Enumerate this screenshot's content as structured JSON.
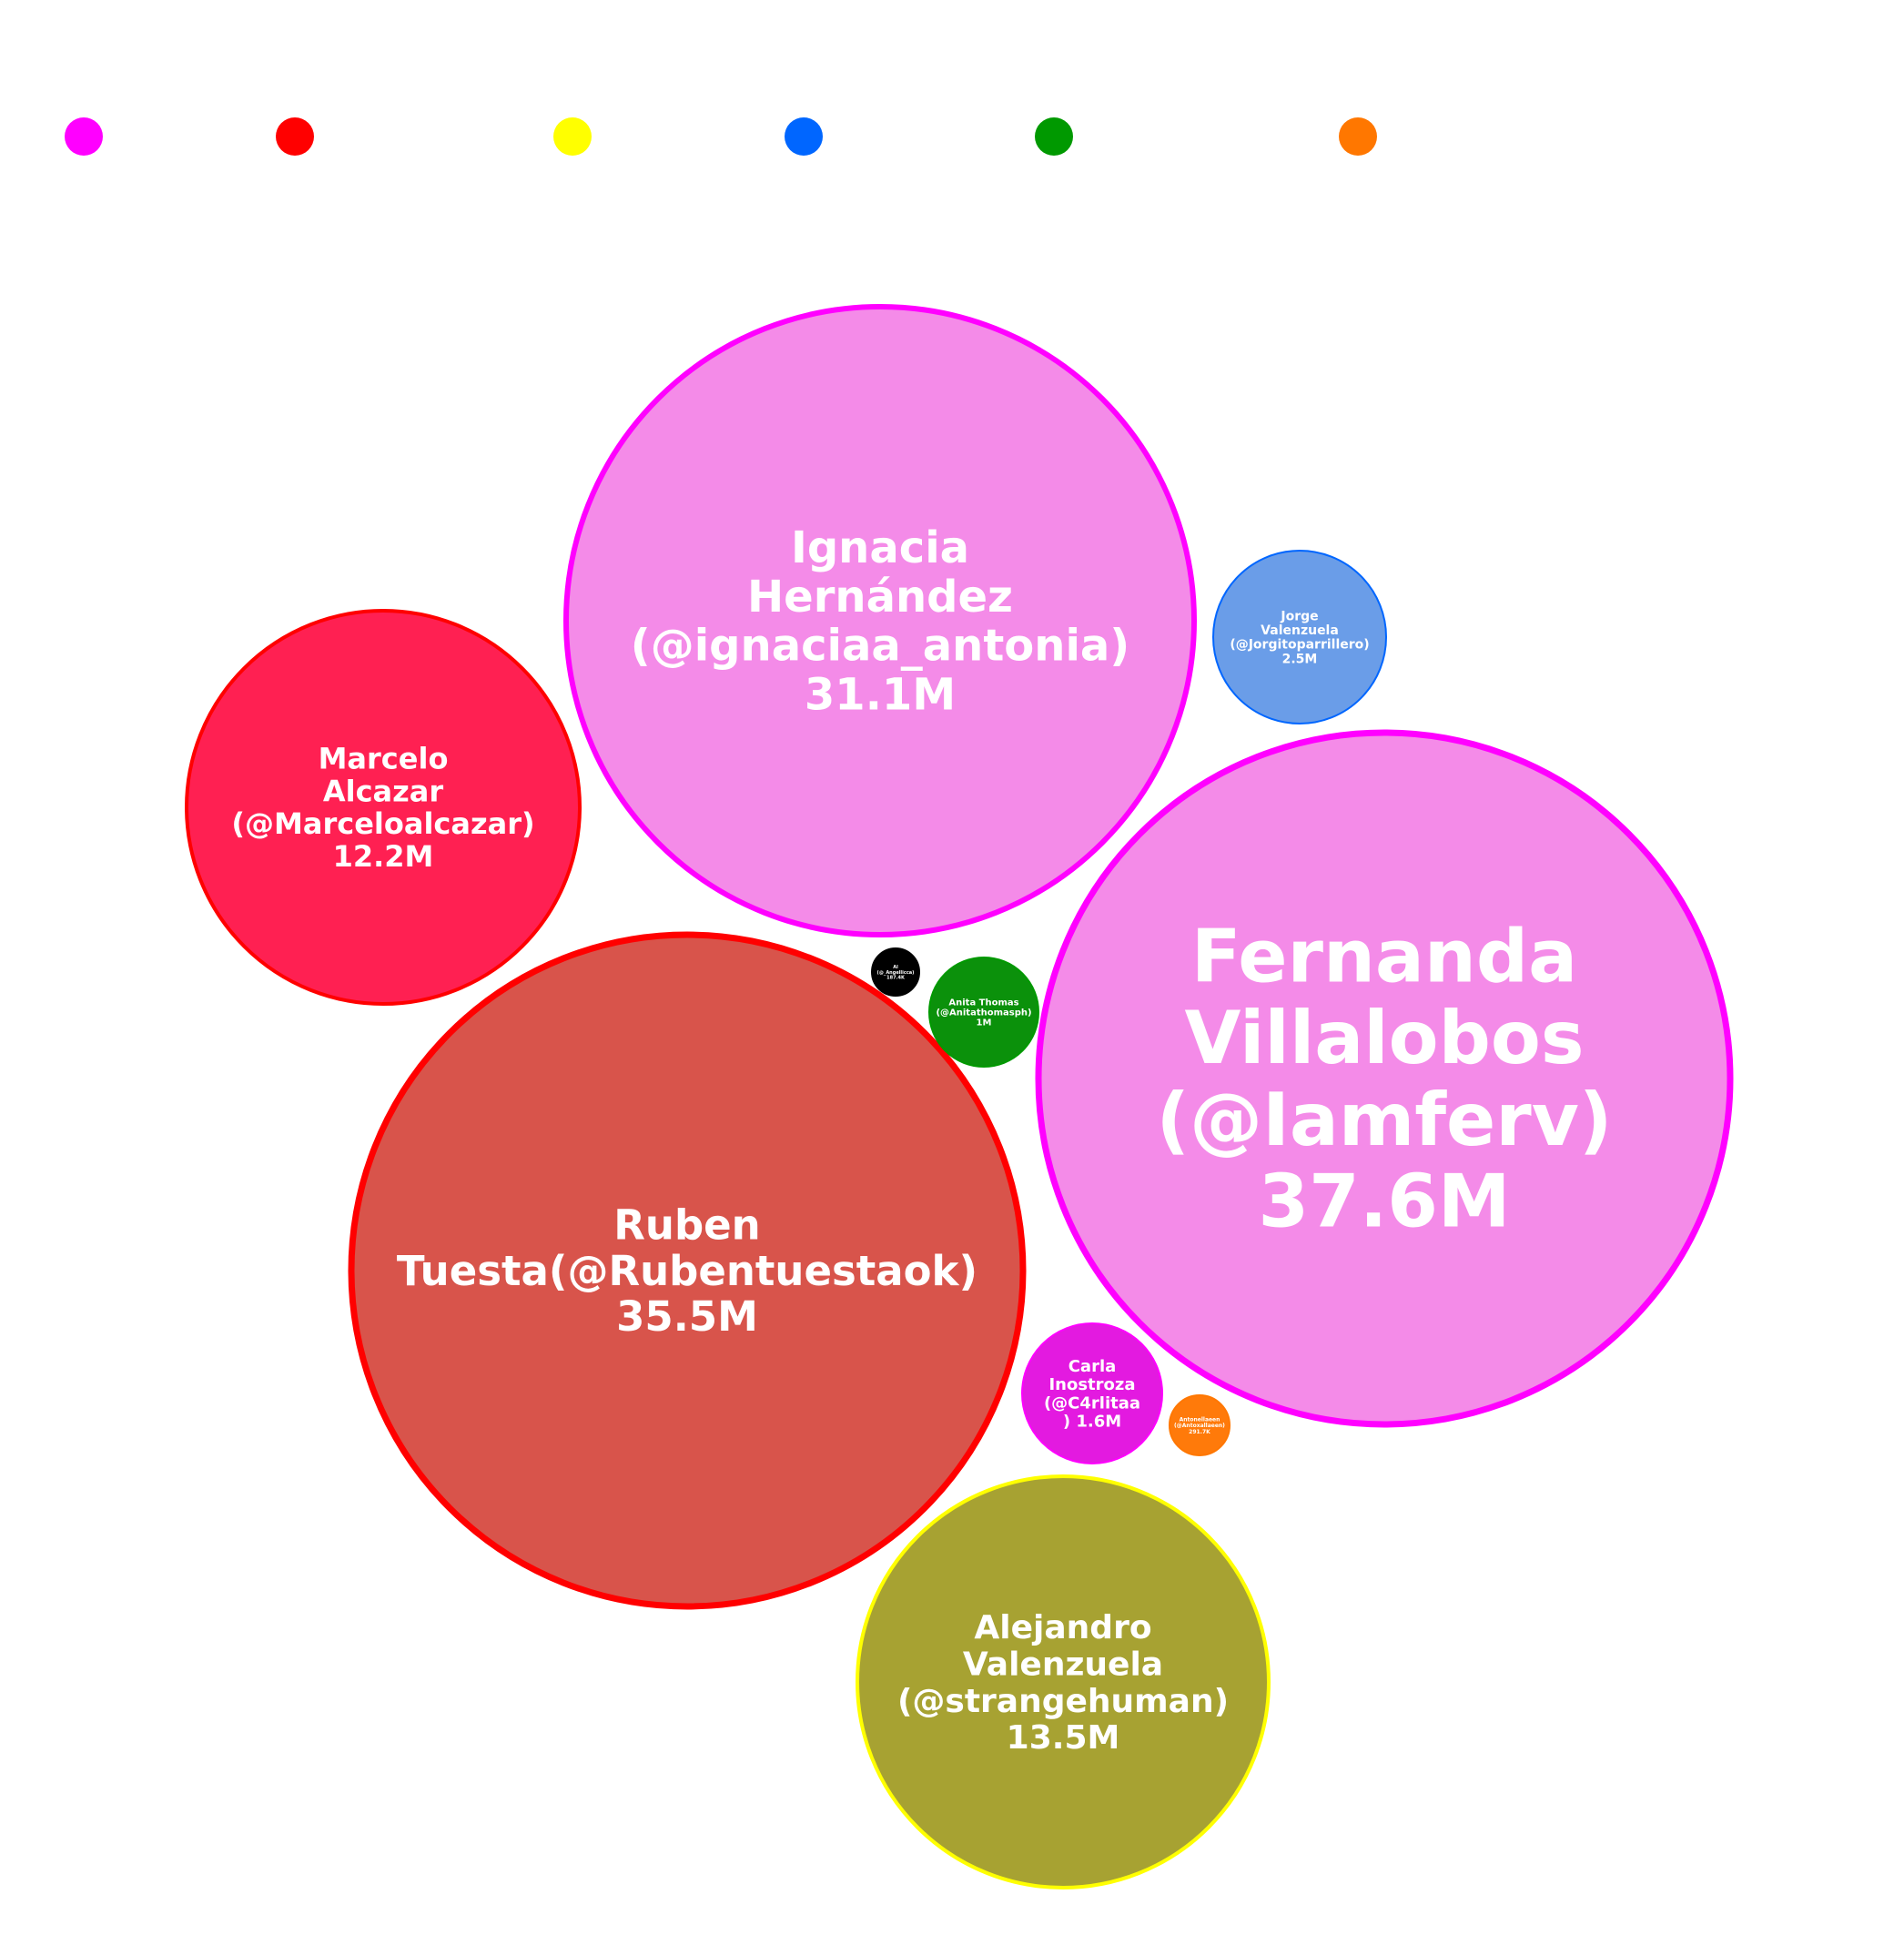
{
  "chart_data": {
    "type": "bubble",
    "legend": {
      "placement": "top-left",
      "colors": [
        "#ff00ff",
        "#ff0000",
        "#ffff00",
        "#0066ff",
        "#009900",
        "#ff7700"
      ]
    },
    "bubbles": [
      {
        "id": "fernanda",
        "lines": [
          "Fernanda",
          "Villalobos",
          "(@Iamferv)",
          "37.6M"
        ],
        "value": 37.6,
        "color": "#ff00ff",
        "fill": "#f48be8"
      },
      {
        "id": "ruben",
        "lines": [
          "Ruben",
          "Tuesta(@Rubentuestaok)",
          "35.5M"
        ],
        "value": 35.5,
        "color": "#ff0000",
        "fill": "#d8544b"
      },
      {
        "id": "ignacia",
        "lines": [
          "Ignacia",
          "Hernández",
          "(@ignaciaa_antonia)",
          "31.1M"
        ],
        "value": 31.1,
        "color": "#ff00ff",
        "fill": "#f48be8"
      },
      {
        "id": "alejandro",
        "lines": [
          "Alejandro",
          "Valenzuela",
          "(@strangehuman)",
          "13.5M"
        ],
        "value": 13.5,
        "color": "#ffff00",
        "fill": "#a7a232"
      },
      {
        "id": "marcelo",
        "lines": [
          "Marcelo",
          "Alcazar",
          "(@Marceloalcazar)",
          "12.2M"
        ],
        "value": 12.2,
        "color": "#ff0000",
        "fill": "#ff2052"
      },
      {
        "id": "jorge",
        "lines": [
          "Jorge",
          "Valenzuela",
          "(@Jorgitoparrillero)",
          "2.5M"
        ],
        "value": 2.5,
        "color": "#0066ff",
        "fill": "#6a9de8"
      },
      {
        "id": "carla",
        "lines": [
          "Carla",
          "Inostroza",
          "(@C4rlitaa",
          ") 1.6M"
        ],
        "value": 1.6,
        "color": "#ff00ff",
        "fill": "#e31ae0"
      },
      {
        "id": "anita",
        "lines": [
          "Anita Thomas",
          "(@Anitathomasph)",
          "1M"
        ],
        "value": 1.0,
        "color": "#009900",
        "fill": "#0b910b"
      },
      {
        "id": "antonella",
        "lines": [
          "Antonellaeen",
          "(@Antoxallaeen)",
          "291.7K"
        ],
        "value": 0.2917,
        "color": "#ff7700",
        "fill": "#ff7a0a"
      },
      {
        "id": "angelo",
        "lines": [
          "Al",
          "(@_Angellicca)",
          "187.4K"
        ],
        "value": 0.1874,
        "color": "#000000",
        "fill": "#000000"
      }
    ]
  }
}
